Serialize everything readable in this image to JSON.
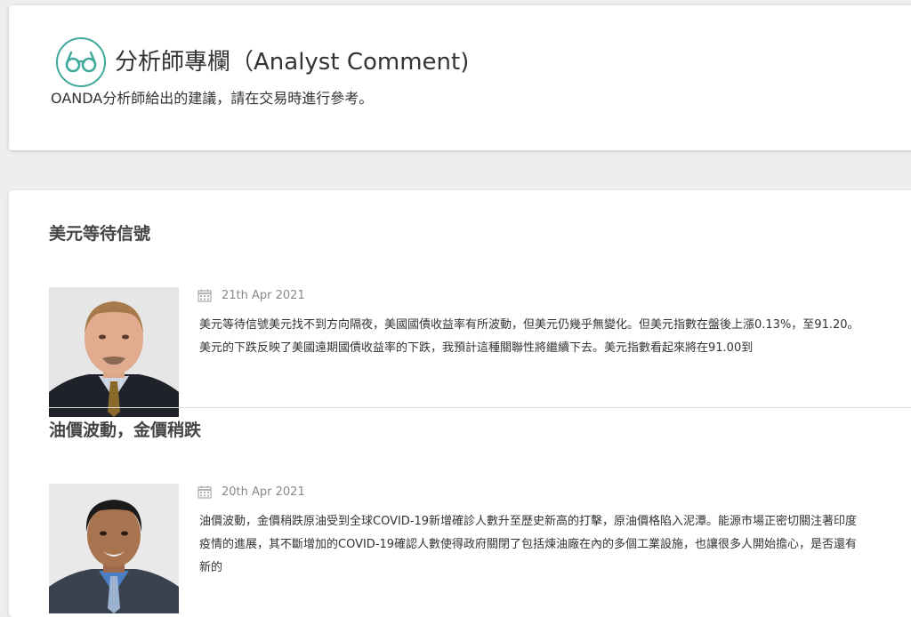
{
  "header": {
    "icon": "glasses-icon",
    "title": "分析師專欄（Analyst Comment)",
    "subtitle": "OANDA分析師給出的建議，請在交易時進行參考。"
  },
  "colors": {
    "accent": "#3fa99b",
    "background": "#eeeeee",
    "card": "#ffffff",
    "date_text": "#8a8a8a"
  },
  "articles": [
    {
      "title": "美元等待信號",
      "date": "21th Apr 2021",
      "photo": "analyst-portrait",
      "excerpt": "美元等待信號美元找不到方向隔夜，美國國債收益率有所波動，但美元仍幾乎無變化。但美元指數在盤後上漲0.13%，至91.20。美元的下跌反映了美國遠期國債收益率的下跌，我預計這種關聯性將繼續下去。美元指數看起來將在91.00到"
    },
    {
      "title": "油價波動，金價稍跌",
      "date": "20th Apr 2021",
      "photo": "analyst-portrait",
      "excerpt": "油價波動，金價稍跌原油受到全球COVID-19新增確診人數升至歷史新高的打擊，原油價格陷入泥潭。能源市場正密切關注著印度疫情的進展，其不斷增加的COVID-19確認人數使得政府關閉了包括煉油廠在內的多個工業設施，也讓很多人開始擔心，是否還有新的"
    }
  ]
}
